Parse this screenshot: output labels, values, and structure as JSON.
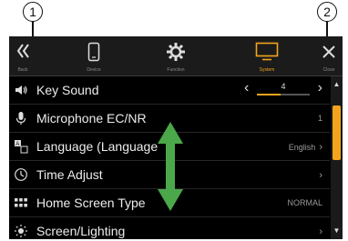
{
  "callouts": {
    "left": "1",
    "right": "2"
  },
  "topbar": {
    "back_label": "Back",
    "tabs": [
      {
        "label": "Device",
        "icon": "phone-icon"
      },
      {
        "label": "Function",
        "icon": "gear-icon"
      },
      {
        "label": "System",
        "icon": "monitor-icon",
        "active": true
      }
    ],
    "close_label": "Close"
  },
  "rows": [
    {
      "label": "Key Sound",
      "icon": "speaker-icon",
      "value": "4",
      "level": 0.45
    },
    {
      "label": "Microphone EC/NR",
      "icon": "microphone-icon",
      "value": "1"
    },
    {
      "label": "Language (Language",
      "icon": "language-icon",
      "value": "English"
    },
    {
      "label": "Time Adjust",
      "icon": "clock-icon",
      "value": ""
    },
    {
      "label": "Home Screen Type",
      "icon": "grid-icon",
      "value": "NORMAL"
    },
    {
      "label": "Screen/Lighting",
      "icon": "brightness-icon",
      "value": ""
    }
  ],
  "colors": {
    "accent": "#f3a41c",
    "arrow": "#4aa84a"
  }
}
